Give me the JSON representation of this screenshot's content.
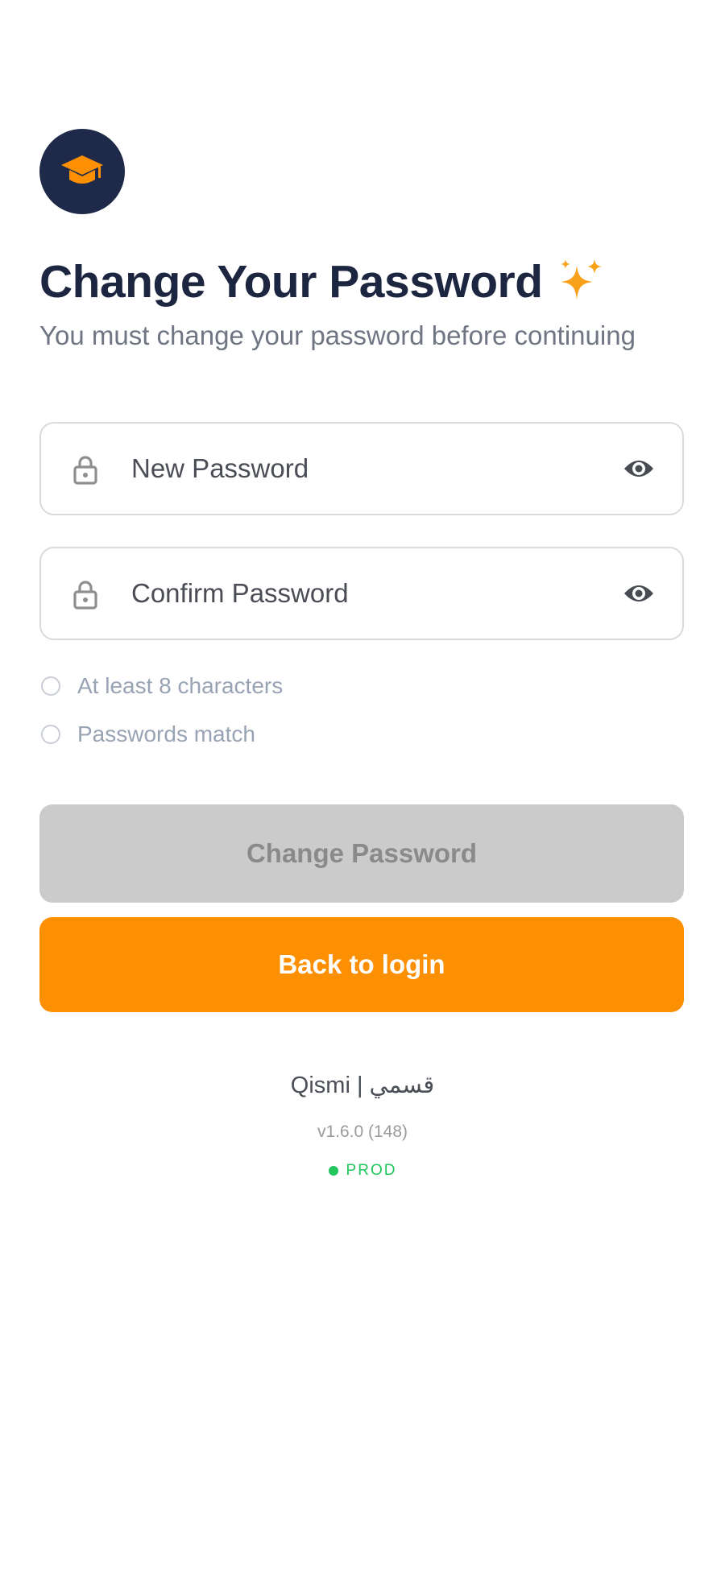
{
  "colors": {
    "brand_navy": "#1f2a4a",
    "accent_orange": "#fd8f02",
    "title_text": "#1d2640",
    "disabled_button": "#cbcbcb",
    "env_status": "#22c55e"
  },
  "header": {
    "logo_icon": "graduation-cap-icon",
    "title": "Change Your Password",
    "title_emoji_icon": "sparkles-icon",
    "subtitle": "You must change your password before continuing"
  },
  "form": {
    "new_password": {
      "placeholder": "New Password",
      "value": "",
      "leading_icon": "lock-icon",
      "trailing_icon": "eye-icon"
    },
    "confirm_password": {
      "placeholder": "Confirm Password",
      "value": "",
      "leading_icon": "lock-icon",
      "trailing_icon": "eye-icon"
    },
    "requirements": [
      {
        "label": "At least 8 characters",
        "met": false
      },
      {
        "label": "Passwords match",
        "met": false
      }
    ],
    "submit_label": "Change Password",
    "submit_enabled": false,
    "back_label": "Back to login"
  },
  "footer": {
    "brand": "Qismi | قسمي",
    "version": "v1.6.0 (148)",
    "environment": "PROD"
  }
}
